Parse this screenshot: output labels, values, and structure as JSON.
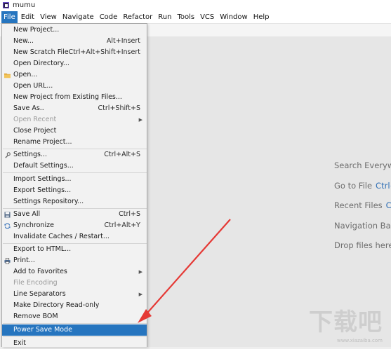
{
  "window": {
    "title": "mumu"
  },
  "menubar": [
    "File",
    "Edit",
    "View",
    "Navigate",
    "Code",
    "Refactor",
    "Run",
    "Tools",
    "VCS",
    "Window",
    "Help"
  ],
  "file_menu": [
    {
      "label": "New Project...",
      "shortcut": ""
    },
    {
      "label": "New...",
      "shortcut": "Alt+Insert"
    },
    {
      "label": "New Scratch File",
      "shortcut": "Ctrl+Alt+Shift+Insert"
    },
    {
      "label": "Open Directory...",
      "shortcut": ""
    },
    {
      "label": "Open...",
      "shortcut": "",
      "icon": "folder-icon"
    },
    {
      "label": "Open URL...",
      "shortcut": ""
    },
    {
      "label": "New Project from Existing Files...",
      "shortcut": ""
    },
    {
      "label": "Save As..",
      "shortcut": "Ctrl+Shift+S"
    },
    {
      "label": "Open Recent",
      "shortcut": "",
      "submenu": true,
      "disabled": true
    },
    {
      "label": "Close Project",
      "shortcut": ""
    },
    {
      "label": "Rename Project...",
      "shortcut": ""
    },
    {
      "label": "Settings...",
      "shortcut": "Ctrl+Alt+S",
      "icon": "wrench-icon"
    },
    {
      "label": "Default Settings...",
      "shortcut": ""
    },
    {
      "label": "Import Settings...",
      "shortcut": ""
    },
    {
      "label": "Export Settings...",
      "shortcut": ""
    },
    {
      "label": "Settings Repository...",
      "shortcut": ""
    },
    {
      "label": "Save All",
      "shortcut": "Ctrl+S",
      "icon": "save-icon"
    },
    {
      "label": "Synchronize",
      "shortcut": "Ctrl+Alt+Y",
      "icon": "sync-icon"
    },
    {
      "label": "Invalidate Caches / Restart...",
      "shortcut": ""
    },
    {
      "label": "Export to HTML...",
      "shortcut": ""
    },
    {
      "label": "Print...",
      "shortcut": "",
      "icon": "printer-icon"
    },
    {
      "label": "Add to Favorites",
      "shortcut": "",
      "submenu": true
    },
    {
      "label": "File Encoding",
      "shortcut": "",
      "disabled": true
    },
    {
      "label": "Line Separators",
      "shortcut": "",
      "submenu": true
    },
    {
      "label": "Make Directory Read-only",
      "shortcut": ""
    },
    {
      "label": "Remove BOM",
      "shortcut": ""
    },
    {
      "label": "Power Save Mode",
      "shortcut": "",
      "selected": true
    },
    {
      "label": "Exit",
      "shortcut": ""
    }
  ],
  "editor_hints": [
    {
      "label": "Search Everyw",
      "shortcut": ""
    },
    {
      "label": "Go to File",
      "shortcut": "Ctrl+"
    },
    {
      "label": "Recent Files",
      "shortcut": "Ct"
    },
    {
      "label": "Navigation Ba",
      "shortcut": ""
    },
    {
      "label": "Drop files here",
      "shortcut": ""
    }
  ],
  "watermark": {
    "text": "下载吧",
    "url": "www.xiazaiba.com"
  },
  "colors": {
    "accent": "#2675bf",
    "annotation_arrow": "#e53935",
    "menu_bg": "#f2f2f2"
  }
}
